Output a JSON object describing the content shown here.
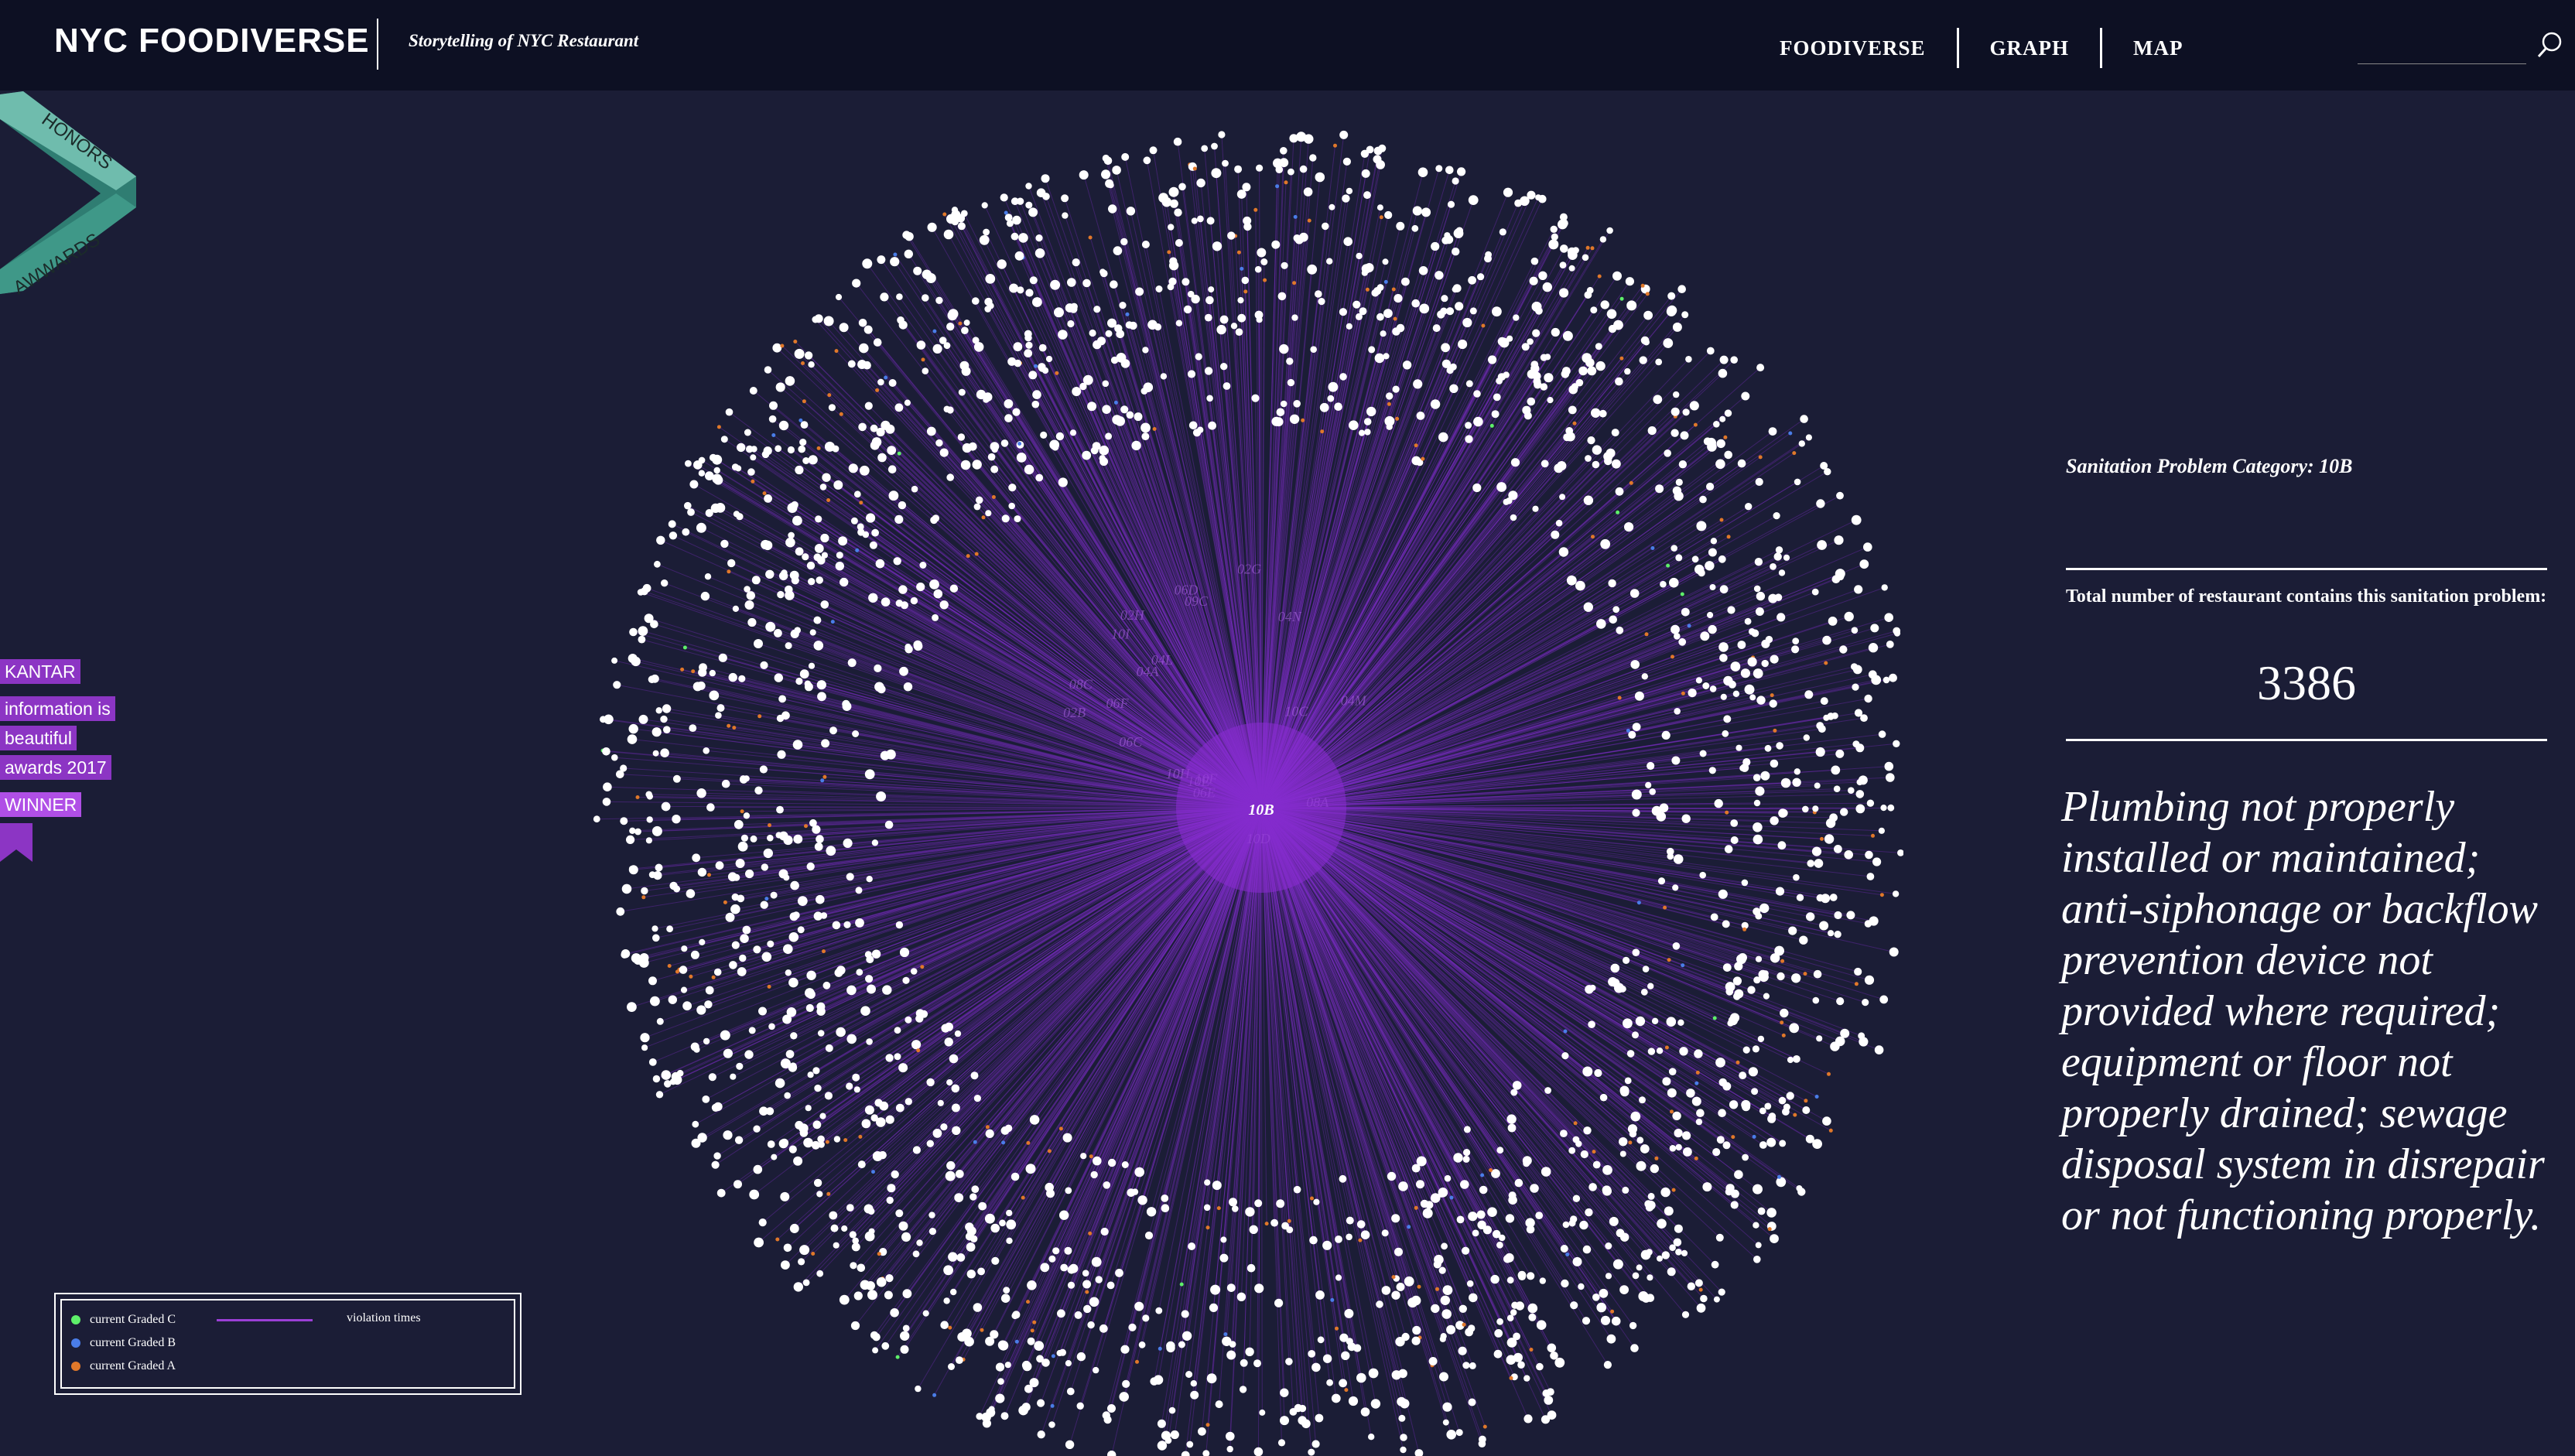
{
  "header": {
    "logo": "NYC FOODIVERSE",
    "tagline": "Storytelling of NYC Restaurant",
    "nav": [
      "FOODIVERSE",
      "GRAPH",
      "MAP"
    ],
    "search_placeholder": ""
  },
  "awards_ribbon": {
    "line1": "HONORS",
    "line2": "AWWARDS"
  },
  "kantar": {
    "brand": "KANTAR",
    "lines": [
      "information is",
      "beautiful",
      "awards 2017"
    ],
    "winner": "WINNER"
  },
  "graph": {
    "center_label": "10B",
    "center_color": "#8a2bd1",
    "link_color": "#7e2ec8",
    "node_color": "#ffffff",
    "satellite_labels": [
      "10C",
      "10F",
      "04N",
      "10D",
      "08A",
      "02G",
      "06D",
      "10E",
      "04L",
      "02B",
      "06C",
      "06F",
      "04M",
      "08C",
      "10H",
      "02H",
      "06E",
      "04A",
      "09C",
      "10I"
    ]
  },
  "legend": {
    "items": [
      {
        "label": "current Graded C",
        "color": "#5ef06a"
      },
      {
        "label": "current Graded B",
        "color": "#4a7de8"
      },
      {
        "label": "current Graded A",
        "color": "#e0782a"
      }
    ],
    "line_label": "violation times",
    "line_color": "#9b3fd6"
  },
  "panel": {
    "category": "Sanitation Problem Category: 10B",
    "total_label": "Total number of restaurant contains this sanitation problem:",
    "count": "3386",
    "description": "Plumbing not properly installed or maintained; anti-siphonage or backflow prevention device not provided where required; equipment or floor not properly drained; sewage disposal system in disrepair or not functioning properly."
  }
}
